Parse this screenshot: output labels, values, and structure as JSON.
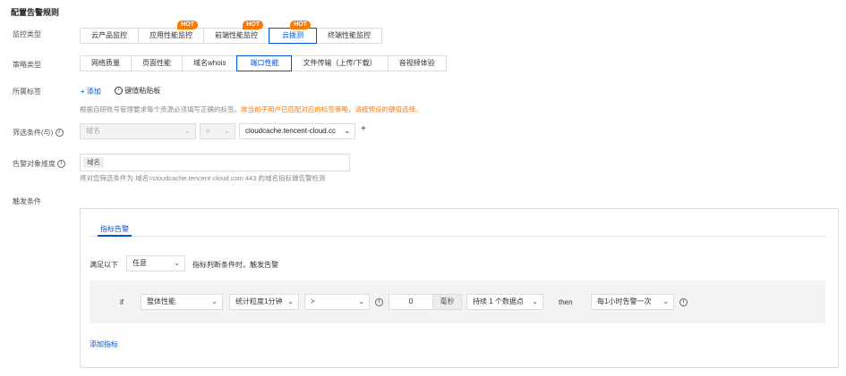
{
  "title": "配置告警规则",
  "monitor_type": {
    "label": "监控类型",
    "options": [
      {
        "label": "云产品监控",
        "hot": ""
      },
      {
        "label": "应用性能监控",
        "hot": "HOT"
      },
      {
        "label": "前端性能监控",
        "hot": "HOT"
      },
      {
        "label": "云拨测",
        "hot": "HOT"
      },
      {
        "label": "终端性能监控",
        "hot": ""
      }
    ],
    "selected": "云拨测"
  },
  "strategy_type": {
    "label": "策略类型",
    "options": [
      "网络质量",
      "页面性能",
      "域名whois",
      "端口性能",
      "文件传输（上传/下载）",
      "音视频体验"
    ],
    "selected": "端口性能"
  },
  "tags": {
    "label": "所属标签",
    "add": "+ 添加",
    "paste": "键值粘贴板",
    "hint_prefix": "根据自研账号管理要求每个资源必须填写正确的标签。",
    "hint_warning": "故当前子用户已匹配对应的标签策略，请按预设的键值选择。"
  },
  "filter": {
    "label": "筛选条件(与)",
    "field": "域名",
    "operator": "=",
    "value": "cloudcache.tencent-cloud.cc",
    "add": "+"
  },
  "dimension": {
    "label": "告警对象维度",
    "tag": "域名",
    "hint": "将对您筛选条件为 域名=cloudcache.tencent-cloud.com:443 的域名指标做告警检测"
  },
  "trigger": {
    "label": "触发条件",
    "tab": "指标告警",
    "satisfy_prefix": "满足以下",
    "satisfy_value": "任意",
    "satisfy_suffix": "指标判断条件时，触发告警",
    "rule": {
      "if": "if",
      "metric": "整体性能",
      "period": "统计粒度1分钟",
      "comparator": ">",
      "threshold": "0",
      "unit": "毫秒",
      "duration": "持续 1 个数据点",
      "then": "then",
      "frequency": "每1小时告警一次"
    },
    "add_metric": "添加指标"
  },
  "colors": {
    "accent": "#0052d9",
    "hot": "#ff7800",
    "warning": "#ff7800"
  },
  "icons": [
    "info-icon",
    "chevron-down-icon",
    "paste-icon",
    "plus-icon"
  ]
}
